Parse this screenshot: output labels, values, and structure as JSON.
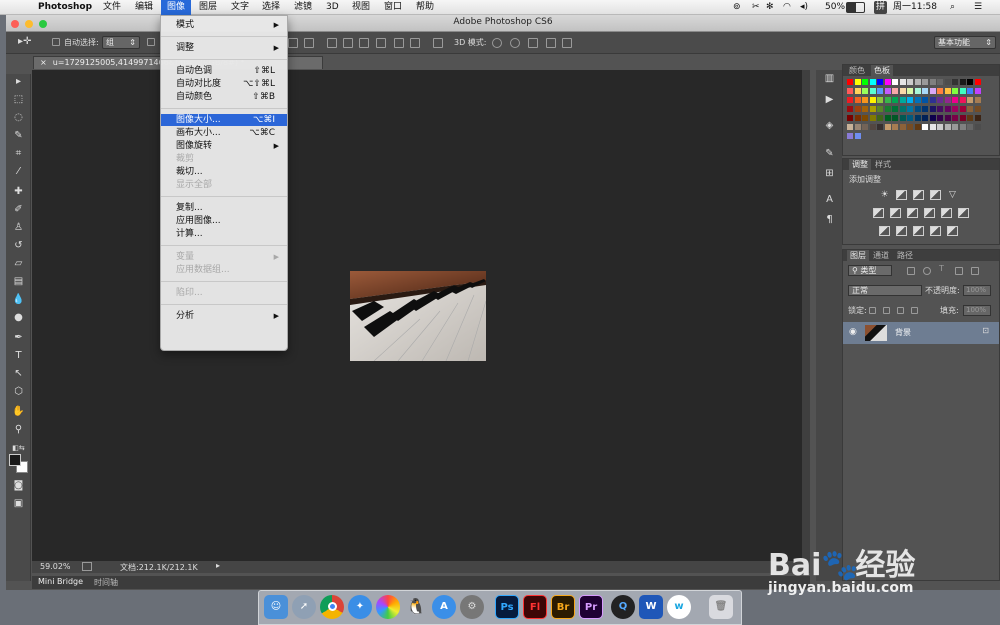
{
  "menubar": {
    "app": "Photoshop",
    "items": [
      "文件",
      "编辑",
      "图像",
      "图层",
      "文字",
      "选择",
      "滤镜",
      "3D",
      "视图",
      "窗口",
      "帮助"
    ],
    "active": "图像",
    "battery": "50%",
    "input": "拼",
    "clock": "周一11:58"
  },
  "window": {
    "title": "Adobe Photoshop CS6",
    "workspace": "基本功能"
  },
  "options": {
    "auto_select_label": "自动选择:",
    "auto_select_value": "组",
    "mode_3d": "3D 模式:"
  },
  "document": {
    "tab_title": "u=1729125005,4149971466&fm=...(RGB/8#) *",
    "zoom": "59.02%",
    "doc_info": "文档:212.1K/212.1K"
  },
  "bottom_tabs": [
    "Mini Bridge",
    "时间轴"
  ],
  "panels": {
    "color_tabs": [
      "颜色",
      "色板"
    ],
    "adjust_tabs": [
      "调整",
      "样式"
    ],
    "adjust_title": "添加调整",
    "layer_tabs": [
      "图层",
      "通道",
      "路径"
    ],
    "kind": "类型",
    "blend": "正常",
    "opacity_label": "不透明度:",
    "opacity": "100%",
    "lock_label": "锁定:",
    "fill_label": "填充:",
    "fill": "100%",
    "layer_name": "背景"
  },
  "image_menu": [
    {
      "label": "模式",
      "arrow": true
    },
    {
      "sep": true
    },
    {
      "label": "调整",
      "arrow": true
    },
    {
      "sep": true
    },
    {
      "label": "自动色调",
      "shortcut": "⇧⌘L"
    },
    {
      "label": "自动对比度",
      "shortcut": "⌥⇧⌘L"
    },
    {
      "label": "自动颜色",
      "shortcut": "⇧⌘B"
    },
    {
      "sep": true
    },
    {
      "label": "图像大小...",
      "shortcut": "⌥⌘I",
      "highlight": true
    },
    {
      "label": "画布大小...",
      "shortcut": "⌥⌘C"
    },
    {
      "label": "图像旋转",
      "arrow": true
    },
    {
      "label": "裁剪",
      "disabled": true
    },
    {
      "label": "裁切..."
    },
    {
      "label": "显示全部",
      "disabled": true
    },
    {
      "sep": true
    },
    {
      "label": "复制..."
    },
    {
      "label": "应用图像..."
    },
    {
      "label": "计算..."
    },
    {
      "sep": true
    },
    {
      "label": "变量",
      "arrow": true,
      "disabled": true
    },
    {
      "label": "应用数据组...",
      "disabled": true
    },
    {
      "sep": true
    },
    {
      "label": "陷印...",
      "disabled": true
    },
    {
      "sep": true
    },
    {
      "label": "分析",
      "arrow": true
    }
  ],
  "watermark": {
    "brand": "Bai",
    "brand2": "经验",
    "url": "jingyan.baidu.com"
  },
  "colors": {
    "accent": "#2769d9",
    "canvas": "#282828"
  }
}
